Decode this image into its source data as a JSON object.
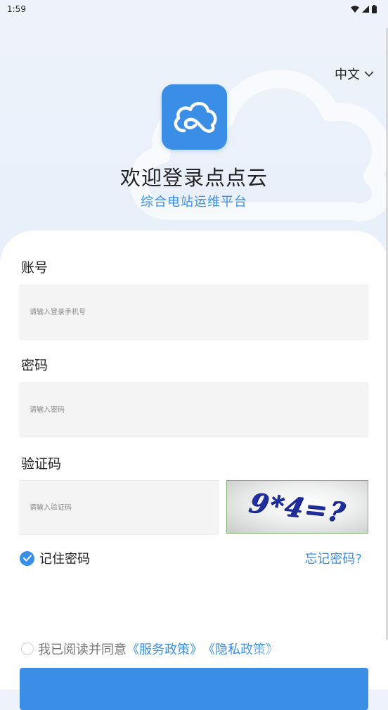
{
  "status_bar": {
    "time": "1:59"
  },
  "language": {
    "selected": "中文"
  },
  "header": {
    "title": "欢迎登录点点云",
    "subtitle": "综合电站运维平台"
  },
  "form": {
    "account": {
      "label": "账号",
      "placeholder": "请输入登录手机号",
      "value": ""
    },
    "password": {
      "label": "密码",
      "placeholder": "请输入密码",
      "value": ""
    },
    "captcha": {
      "label": "验证码",
      "placeholder": "请输入验证码",
      "value": "",
      "image_text": "9*4=?"
    },
    "remember_label": "记住密码",
    "remember_checked": true,
    "forgot_label": "忘记密码?"
  },
  "agreement": {
    "prefix": "我已阅读并同意",
    "service_link": "《服务政策》",
    "privacy_link": "《隐私政策》",
    "checked": false
  },
  "colors": {
    "accent": "#3a8ee6",
    "text": "#222222",
    "input_bg": "#f4f4f4"
  }
}
